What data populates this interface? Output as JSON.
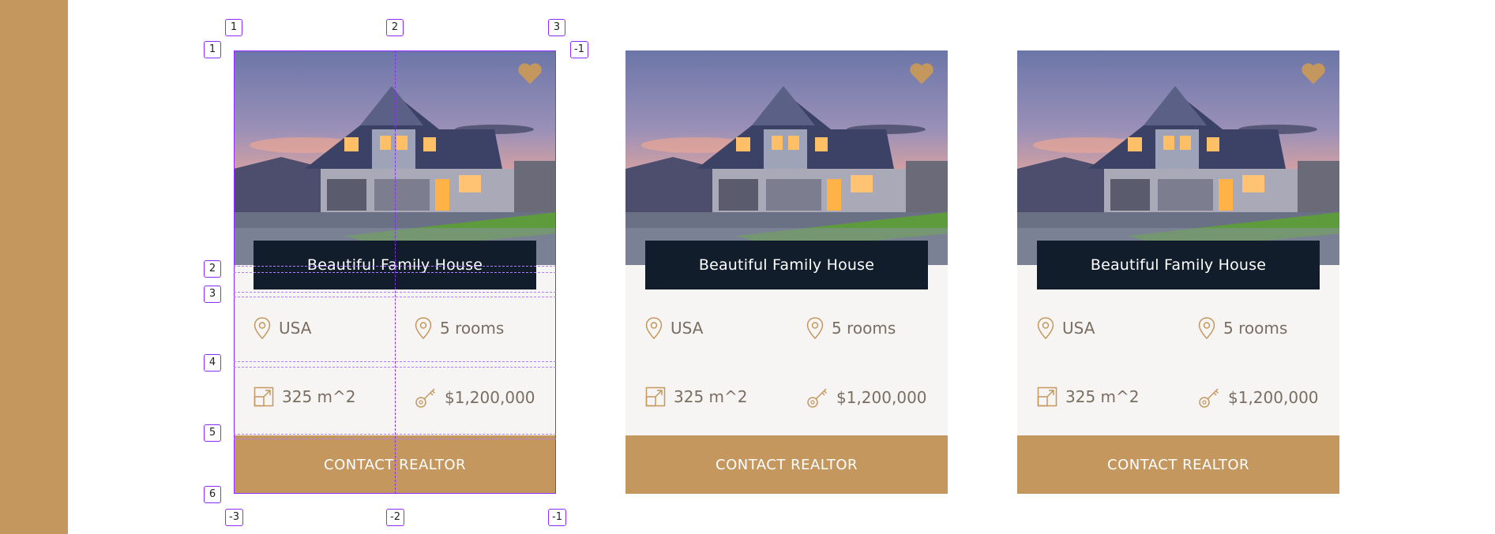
{
  "colors": {
    "accent": "#c4975f",
    "title_bg": "#111d2a",
    "card_bg": "#f7f5f3",
    "guide": "#8b2bff"
  },
  "cards": [
    {
      "title": "Beautiful Family House",
      "location": "USA",
      "rooms": "5 rooms",
      "area": "325 m^2",
      "price": "$1,200,000",
      "cta": "CONTACT REALTOR",
      "icons": [
        "heart-icon",
        "location-pin-icon",
        "location-pin-icon",
        "area-icon",
        "key-icon"
      ]
    },
    {
      "title": "Beautiful Family House",
      "location": "USA",
      "rooms": "5 rooms",
      "area": "325 m^2",
      "price": "$1,200,000",
      "cta": "CONTACT REALTOR",
      "icons": [
        "heart-icon",
        "location-pin-icon",
        "location-pin-icon",
        "area-icon",
        "key-icon"
      ]
    },
    {
      "title": "Beautiful Family House",
      "location": "USA",
      "rooms": "5 rooms",
      "area": "325 m^2",
      "price": "$1,200,000",
      "cta": "CONTACT REALTOR",
      "icons": [
        "heart-icon",
        "location-pin-icon",
        "location-pin-icon",
        "area-icon",
        "key-icon"
      ]
    }
  ],
  "guides": {
    "top": [
      "1",
      "2",
      "3"
    ],
    "top_right": "-1",
    "left": [
      "1",
      "2",
      "3",
      "4",
      "5",
      "6"
    ],
    "bottom": [
      "-3",
      "-2",
      "-1"
    ]
  }
}
